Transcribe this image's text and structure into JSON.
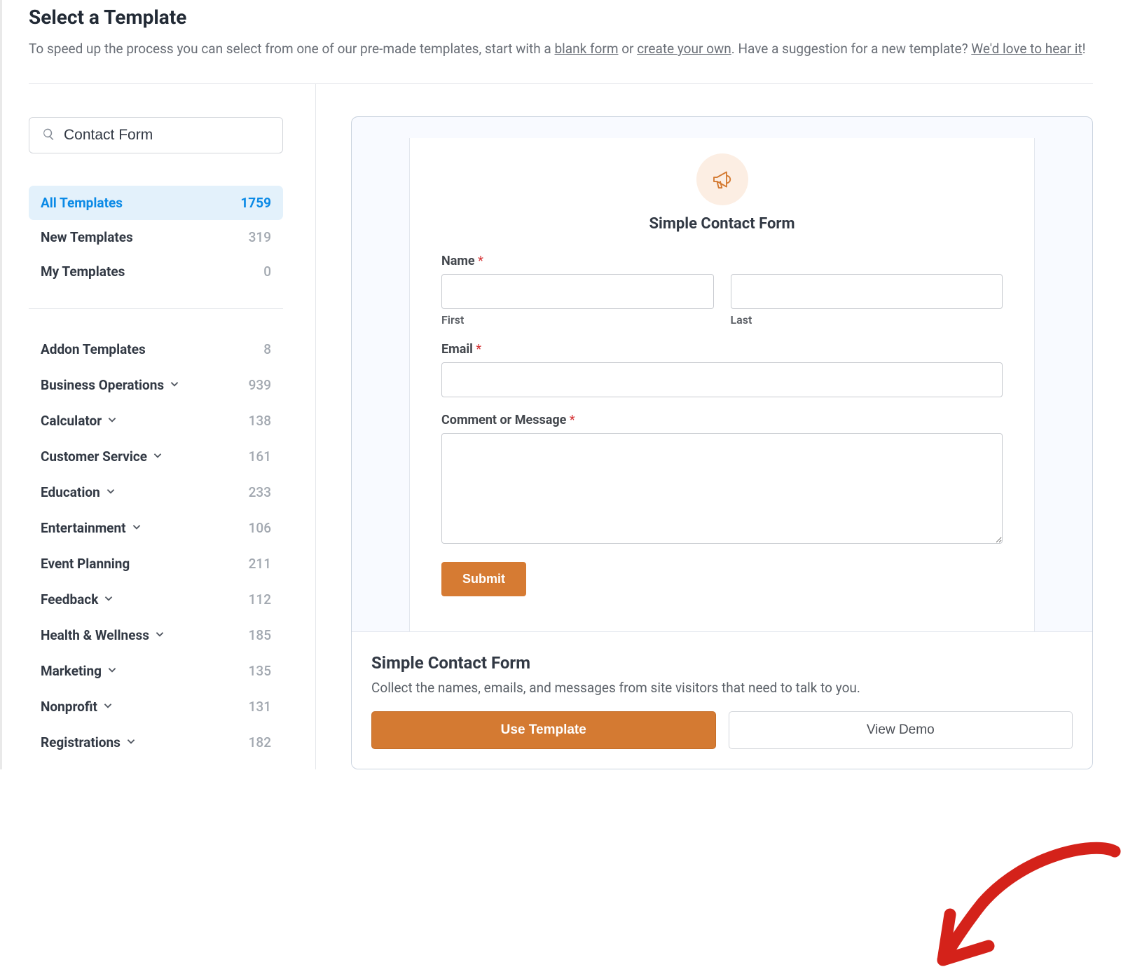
{
  "header": {
    "title": "Select a Template",
    "sub_prefix": "To speed up the process you can select from one of our pre-made templates, start with a ",
    "link_blank": "blank form",
    "sub_or": " or ",
    "link_create": "create your own",
    "sub_mid": ". Have a suggestion for a new template? ",
    "link_hear": "We'd love to hear it",
    "sub_suffix": "!"
  },
  "search": {
    "value": "Contact Form"
  },
  "top_categories": [
    {
      "label": "All Templates",
      "count": "1759",
      "active": true
    },
    {
      "label": "New Templates",
      "count": "319",
      "active": false
    },
    {
      "label": "My Templates",
      "count": "0",
      "active": false
    }
  ],
  "categories": [
    {
      "label": "Addon Templates",
      "count": "8",
      "expandable": false
    },
    {
      "label": "Business Operations",
      "count": "939",
      "expandable": true
    },
    {
      "label": "Calculator",
      "count": "138",
      "expandable": true
    },
    {
      "label": "Customer Service",
      "count": "161",
      "expandable": true
    },
    {
      "label": "Education",
      "count": "233",
      "expandable": true
    },
    {
      "label": "Entertainment",
      "count": "106",
      "expandable": true
    },
    {
      "label": "Event Planning",
      "count": "211",
      "expandable": false
    },
    {
      "label": "Feedback",
      "count": "112",
      "expandable": true
    },
    {
      "label": "Health & Wellness",
      "count": "185",
      "expandable": true
    },
    {
      "label": "Marketing",
      "count": "135",
      "expandable": true
    },
    {
      "label": "Nonprofit",
      "count": "131",
      "expandable": true
    },
    {
      "label": "Registrations",
      "count": "182",
      "expandable": true
    }
  ],
  "form": {
    "icon": "megaphone-icon",
    "title": "Simple Contact Form",
    "name_label": "Name",
    "first_label": "First",
    "last_label": "Last",
    "email_label": "Email",
    "comment_label": "Comment or Message",
    "submit_label": "Submit"
  },
  "footer": {
    "title": "Simple Contact Form",
    "desc": "Collect the names, emails, and messages from site visitors that need to talk to you.",
    "primary": "Use Template",
    "secondary": "View Demo"
  },
  "colors": {
    "accent": "#d47a32",
    "link": "#0b8ae6"
  }
}
